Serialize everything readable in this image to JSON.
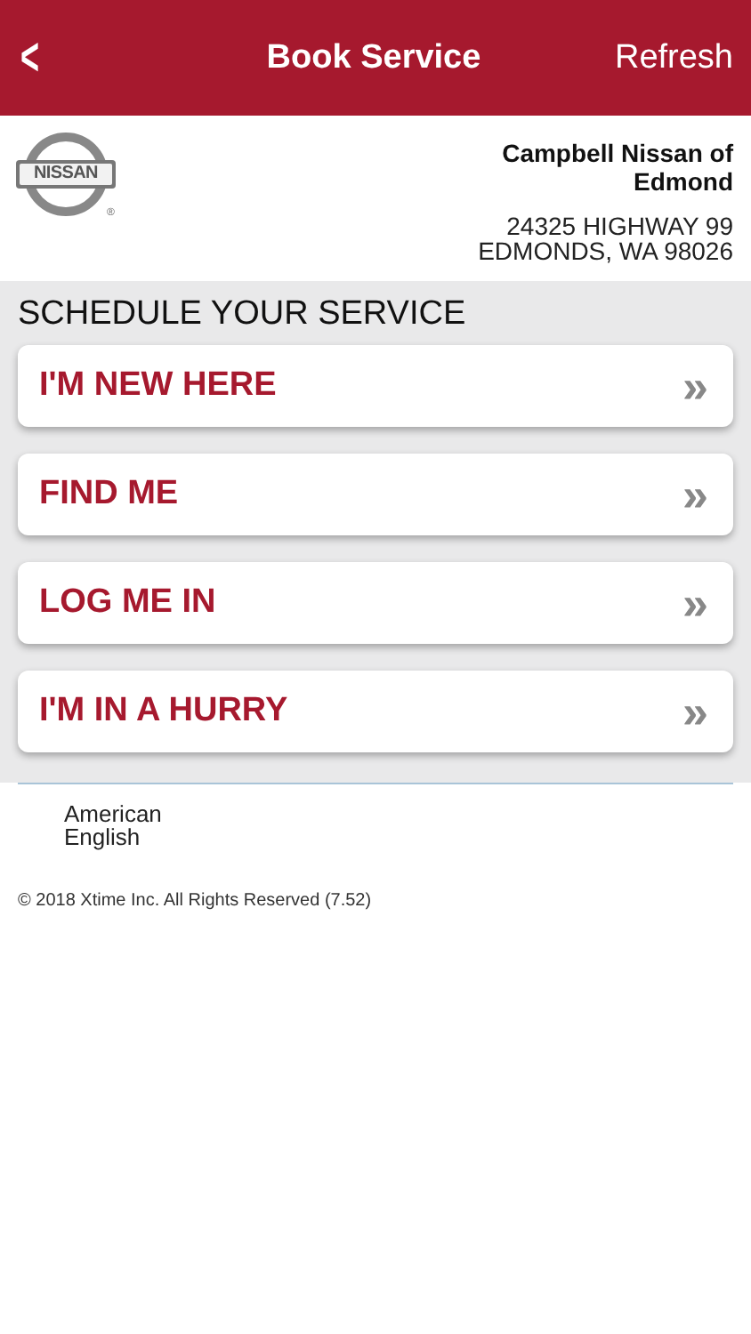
{
  "nav_bar": {
    "back": "<",
    "title": "Book Service",
    "action": "Refresh"
  },
  "dealer": {
    "logo": {
      "text": "NISSAN",
      "mark": "®"
    },
    "name": "Campbell Nissan of Edmond",
    "address_lines": [
      "24325 HIGHWAY 99",
      "EDMONDS, WA 98026"
    ]
  },
  "section_title": "SCHEDULE YOUR SERVICE",
  "options": [
    {
      "label": "I'M NEW HERE",
      "chevron": "»"
    },
    {
      "label": "FIND ME",
      "chevron": "»"
    },
    {
      "label": "LOG ME IN",
      "chevron": "»"
    },
    {
      "label": "I'M IN A HURRY",
      "chevron": "»"
    }
  ],
  "language": "American English",
  "footer": "© 2018 Xtime Inc. All Rights Reserved (7.52)"
}
